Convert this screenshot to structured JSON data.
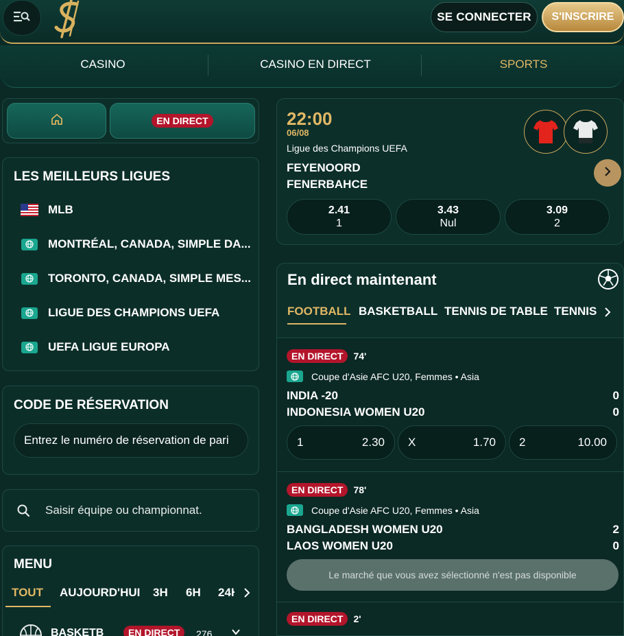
{
  "header": {
    "login_label": "SE CONNECTER",
    "signup_label": "S'INSCRIRE",
    "menu_icon": "menu-search-icon",
    "logo_icon": "brand-logo-icon",
    "accent_color": "#c9a85c"
  },
  "nav": {
    "items": [
      {
        "label": "CASINO",
        "active": false
      },
      {
        "label": "CASINO EN DIRECT",
        "active": false
      },
      {
        "label": "SPORTS",
        "active": true
      }
    ]
  },
  "quick": {
    "home_icon": "home-icon",
    "live_label": "EN DIRECT"
  },
  "top_leagues": {
    "title": "LES MEILLEURS LIGUES",
    "items": [
      {
        "label": "MLB",
        "icon": "us-flag-icon"
      },
      {
        "label": "MONTRÉAL, CANADA, SIMPLE DA...",
        "icon": "globe-icon"
      },
      {
        "label": "TORONTO, CANADA, SIMPLE MES...",
        "icon": "globe-icon"
      },
      {
        "label": "LIGUE DES CHAMPIONS UEFA",
        "icon": "globe-icon"
      },
      {
        "label": "UEFA LIGUE EUROPA",
        "icon": "globe-icon"
      }
    ]
  },
  "booking": {
    "title": "CODE DE RÉSERVATION",
    "placeholder": "Entrez le numéro de réservation de pari"
  },
  "search": {
    "placeholder": "Saisir équipe ou championnat."
  },
  "menu": {
    "title": "MENU",
    "tabs": [
      "TOUT",
      "AUJOURD'HUI",
      "3H",
      "6H",
      "24H"
    ],
    "active_tab": "TOUT",
    "first_item": {
      "label": "BASKETB",
      "badge": "EN DIRECT",
      "count": "276"
    }
  },
  "featured": {
    "time": "22:00",
    "date": "06/08",
    "league": "Ligue des Champions UEFA",
    "home": "FEYENOORD",
    "away": "FENERBAHCE",
    "odds": [
      {
        "value": "2.41",
        "label": "1"
      },
      {
        "value": "3.43",
        "label": "Nul"
      },
      {
        "value": "3.09",
        "label": "2"
      }
    ],
    "home_jersey_color": "#e3241c",
    "away_jersey_color": "#e9ecea"
  },
  "live": {
    "title": "En direct maintenant",
    "tabs": [
      "FOOTBALL",
      "BASKETBALL",
      "TENNIS DE TABLE",
      "TENNIS"
    ],
    "active_tab": "FOOTBALL",
    "events": [
      {
        "badge": "EN DIRECT",
        "minute": "74'",
        "competition": "Coupe d'Asie AFC U20, Femmes • Asia",
        "home": "INDIA -20",
        "away": "INDONESIA WOMEN U20",
        "home_score": "0",
        "away_score": "0",
        "selections": [
          {
            "label": "1",
            "odd": "2.30"
          },
          {
            "label": "X",
            "odd": "1.70"
          },
          {
            "label": "2",
            "odd": "10.00"
          }
        ]
      },
      {
        "badge": "EN DIRECT",
        "minute": "78'",
        "competition": "Coupe d'Asie AFC U20, Femmes • Asia",
        "home": "BANGLADESH WOMEN U20",
        "away": "LAOS WOMEN U20",
        "home_score": "2",
        "away_score": "0",
        "unavailable": "Le marché que vous avez sélectionné n'est pas disponible"
      },
      {
        "badge": "EN DIRECT",
        "minute": "2'"
      }
    ]
  }
}
